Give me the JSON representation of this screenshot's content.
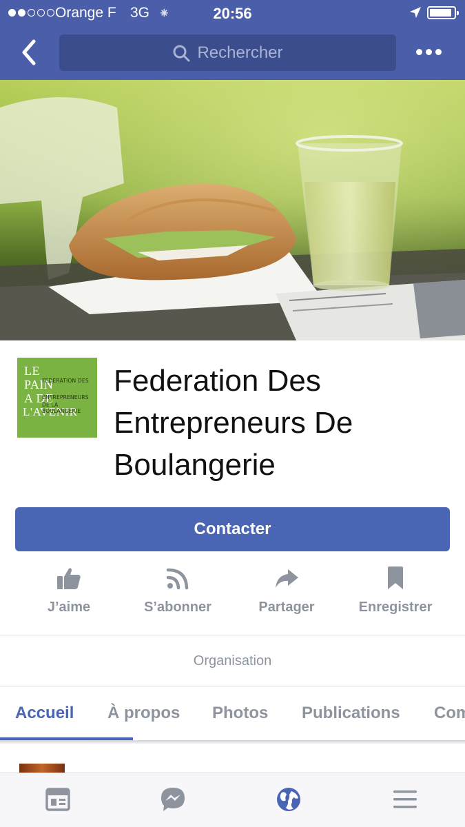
{
  "status_bar": {
    "carrier": "Orange F",
    "network": "3G",
    "time": "20:56",
    "signal_bars_filled": 2,
    "signal_bars_total": 5,
    "battery_level": 0.9
  },
  "nav": {
    "search_placeholder": "Rechercher",
    "back_icon": "chevron-left-icon",
    "more_icon": "more-dots-icon"
  },
  "cover": {
    "description_icon": "cover-photo"
  },
  "page": {
    "logo_text": {
      "line1": "LE",
      "line2": "PAIN",
      "line3": "A DE",
      "line4": "L'AVENIR",
      "small1": "FEDERATION DES",
      "small2": "ENTREPRENEURS",
      "small3": "DE LA BOULANGERIE"
    },
    "name_line1": "Federation Des",
    "name_line2": "Entrepreneurs De",
    "name_line3": "Boulangerie",
    "contact_label": "Contacter",
    "category": "Organisation"
  },
  "actions": [
    {
      "label": "J’aime",
      "icon": "thumbs-up-icon"
    },
    {
      "label": "S’abonner",
      "icon": "rss-icon"
    },
    {
      "label": "Partager",
      "icon": "share-arrow-icon"
    },
    {
      "label": "Enregistrer",
      "icon": "bookmark-icon"
    }
  ],
  "tabs": [
    {
      "label": "Accueil",
      "active": true
    },
    {
      "label": "À propos",
      "active": false
    },
    {
      "label": "Photos",
      "active": false
    },
    {
      "label": "Publications",
      "active": false
    },
    {
      "label": "Communauté",
      "active": false
    }
  ],
  "bottom_nav": [
    {
      "icon": "news-feed-icon",
      "active": false
    },
    {
      "icon": "messenger-icon",
      "active": false
    },
    {
      "icon": "globe-icon",
      "active": true
    },
    {
      "icon": "menu-icon",
      "active": false
    }
  ],
  "colors": {
    "brand_blue": "#4a5ea9",
    "button_blue": "#4a65b3",
    "logo_green": "#7ab342",
    "muted_gray": "#8d949e"
  }
}
